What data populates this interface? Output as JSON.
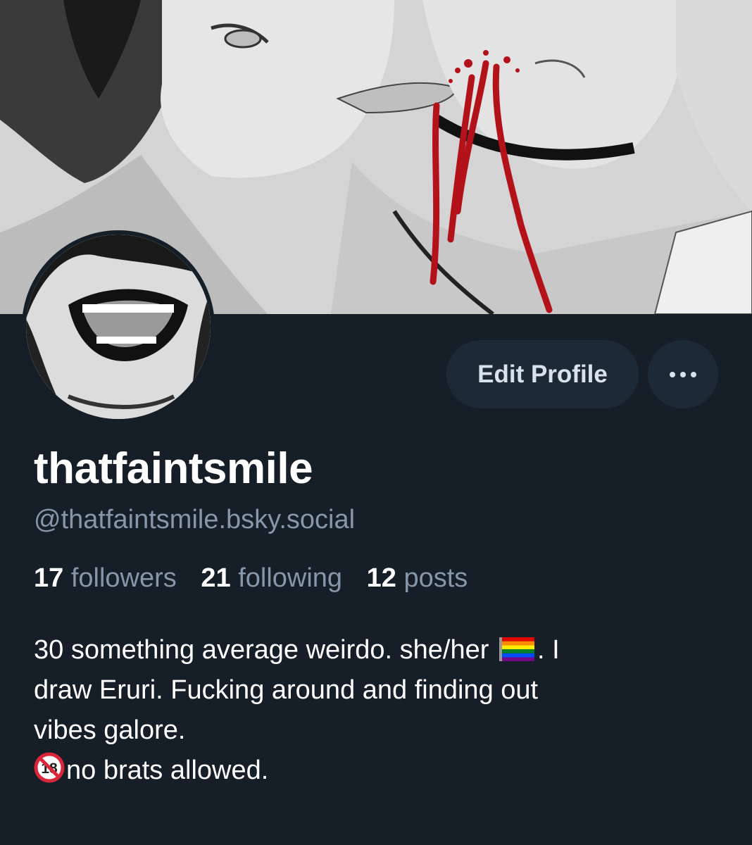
{
  "profile": {
    "display_name": "thatfaintsmile",
    "handle": "@thatfaintsmile.bsky.social"
  },
  "actions": {
    "edit_profile_label": "Edit Profile",
    "more_icon": "ellipsis-icon"
  },
  "stats": {
    "followers_count": "17",
    "followers_label": "followers",
    "following_count": "21",
    "following_label": "following",
    "posts_count": "12",
    "posts_label": "posts"
  },
  "bio": {
    "line1_a": "30 something average weirdo. she/her",
    "flag_icon": "rainbow-flag-icon",
    "line1_b": ".  I",
    "line2": "draw Eruri. Fucking around and finding out",
    "line3": "vibes galore.",
    "no18_icon": "no-under-18-icon",
    "line4": "no brats allowed."
  },
  "colors": {
    "background": "#161e27",
    "button_bg": "#1e2936",
    "muted_text": "#8796a8",
    "blood": "#b3121a"
  }
}
